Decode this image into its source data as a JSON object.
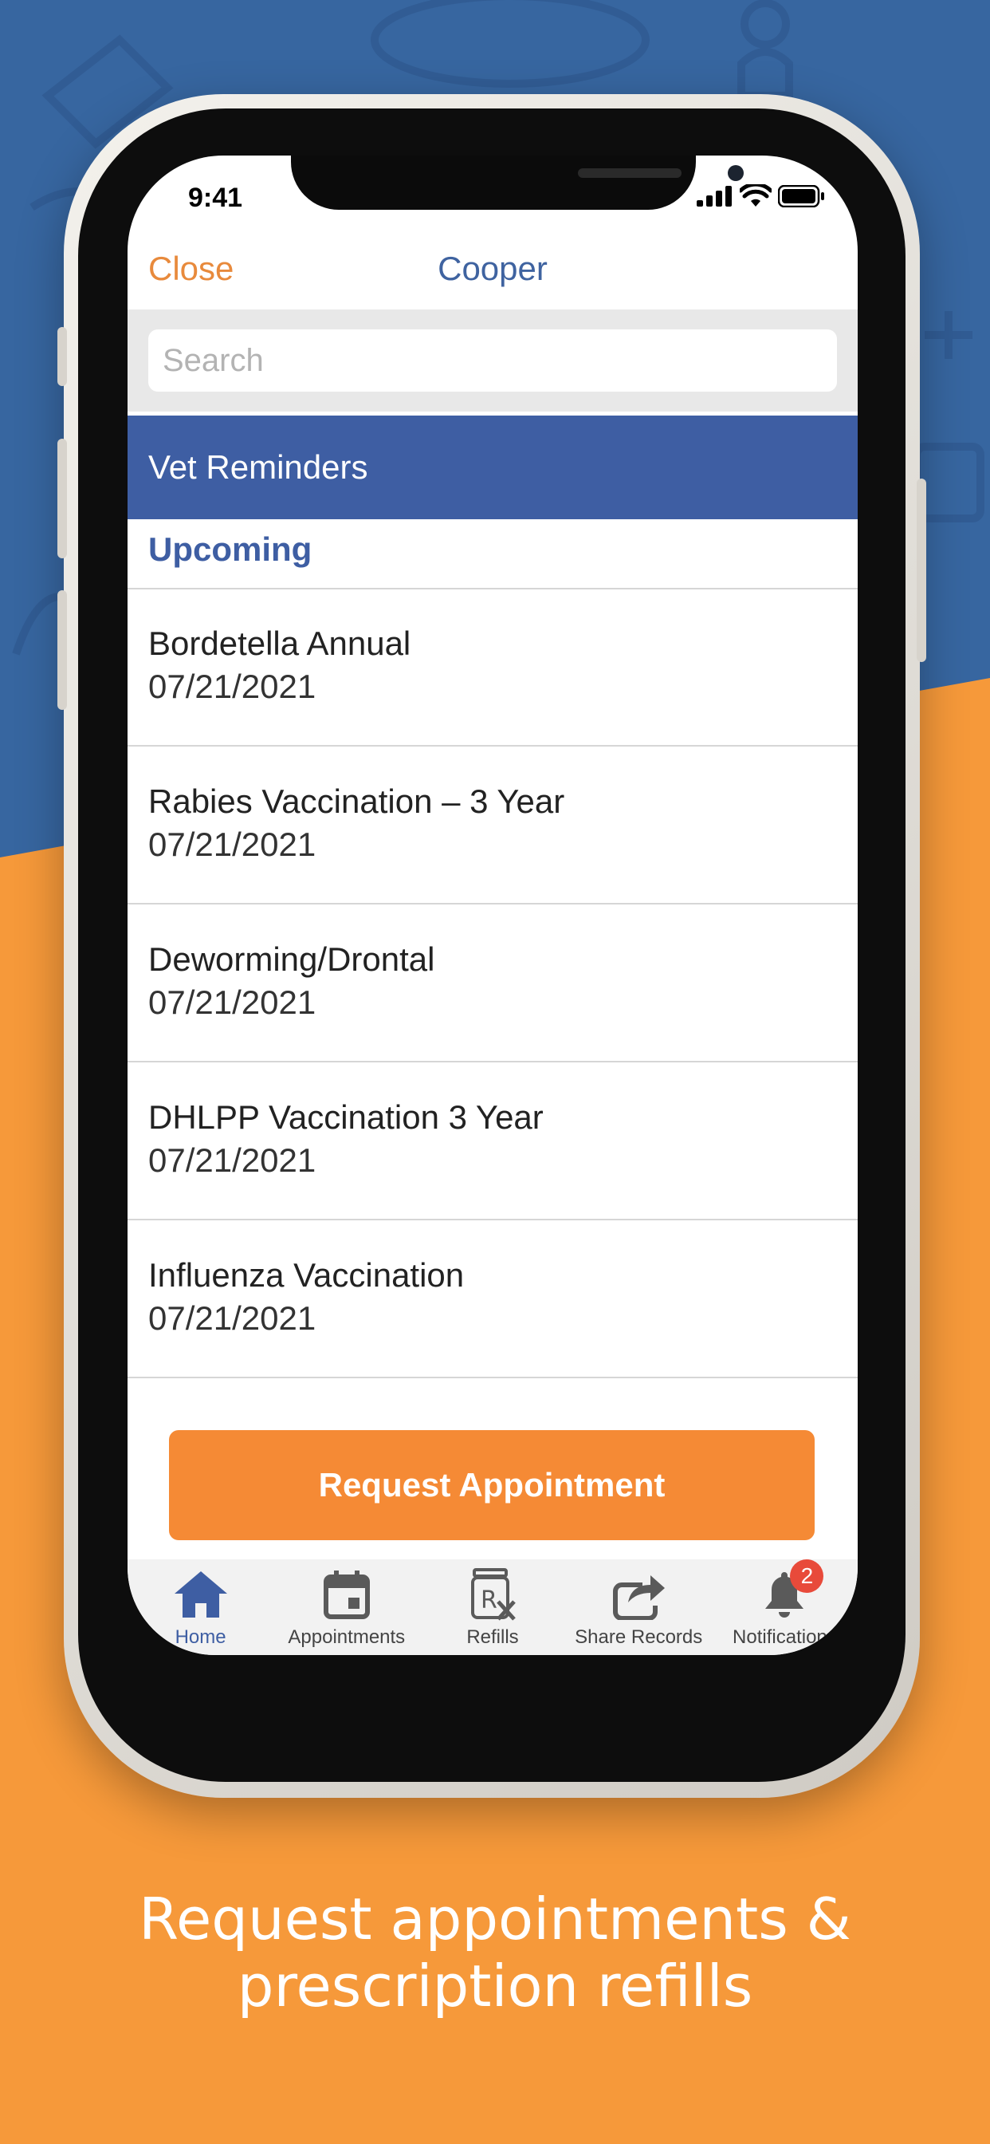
{
  "status_bar": {
    "time": "9:41"
  },
  "nav": {
    "close_label": "Close",
    "title": "Cooper"
  },
  "search": {
    "placeholder": "Search"
  },
  "section": {
    "title": "Vet Reminders",
    "subtitle": "Upcoming"
  },
  "reminders": [
    {
      "title": "Bordetella Annual",
      "date": "07/21/2021"
    },
    {
      "title": "Rabies Vaccination – 3 Year",
      "date": "07/21/2021"
    },
    {
      "title": "Deworming/Drontal",
      "date": "07/21/2021"
    },
    {
      "title": "DHLPP Vaccination 3 Year",
      "date": "07/21/2021"
    },
    {
      "title": "Influenza Vaccination",
      "date": "07/21/2021"
    }
  ],
  "request_button": {
    "label": "Request Appointment"
  },
  "tabs": [
    {
      "label": "Home",
      "icon": "home-icon",
      "active": true
    },
    {
      "label": "Appointments",
      "icon": "calendar-icon"
    },
    {
      "label": "Refills",
      "icon": "prescription-icon"
    },
    {
      "label": "Share Records",
      "icon": "share-icon"
    },
    {
      "label": "Notifications",
      "icon": "bell-icon",
      "badge": "2"
    }
  ],
  "caption": {
    "line1": "Request appointments &",
    "line2": "prescription refills"
  },
  "colors": {
    "accent_orange": "#f58a35",
    "brand_blue": "#3e5ea3",
    "background_blue": "#3766a0",
    "background_orange": "#f6993a"
  }
}
